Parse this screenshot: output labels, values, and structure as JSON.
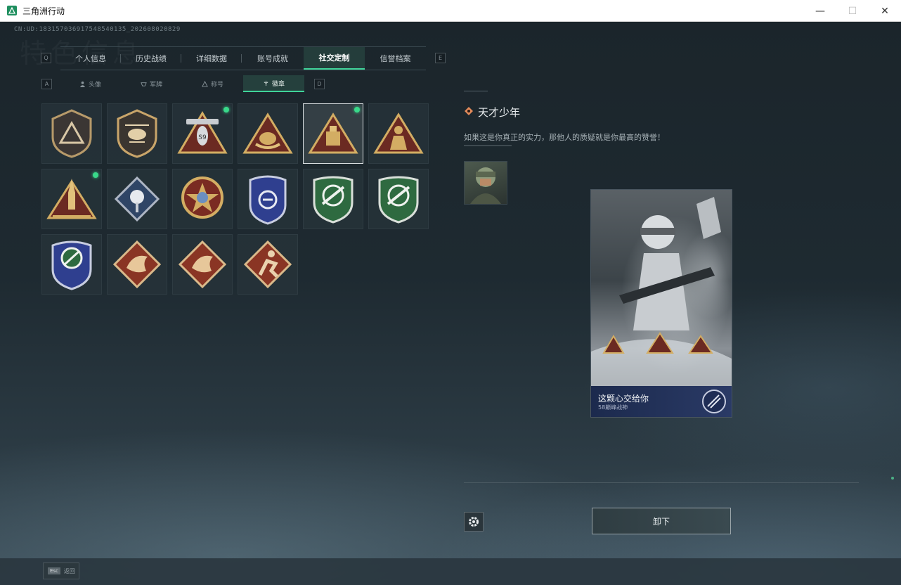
{
  "window": {
    "title": "三角洲行动",
    "minimize": "—",
    "maximize": "☐",
    "close": "✕"
  },
  "uid": "CN:UD:183157036917548540135_202608020829",
  "watermark": "特色信息",
  "main_tabs": {
    "left_key": "Q",
    "right_key": "E",
    "items": [
      {
        "label": "个人信息",
        "active": false
      },
      {
        "label": "历史战绩",
        "active": false
      },
      {
        "label": "详细数据",
        "active": false
      },
      {
        "label": "账号成就",
        "active": false
      },
      {
        "label": "社交定制",
        "active": true
      },
      {
        "label": "信誉档案",
        "active": false
      }
    ]
  },
  "sub_tabs": {
    "left_key": "A",
    "right_key": "D",
    "items": [
      {
        "label": "头像",
        "icon": "person-icon",
        "active": false
      },
      {
        "label": "军牌",
        "icon": "dogtag-icon",
        "active": false
      },
      {
        "label": "称号",
        "icon": "title-icon",
        "active": false
      },
      {
        "label": "徽章",
        "icon": "badge-icon",
        "active": true
      }
    ]
  },
  "badges": [
    {
      "icon": "shield-triangle-badge-icon",
      "new": false,
      "selected": false
    },
    {
      "icon": "helicopter-badge-icon",
      "new": false,
      "selected": false
    },
    {
      "icon": "s59-triangle-badge-icon",
      "new": true,
      "selected": false
    },
    {
      "icon": "nest-triangle-badge-icon",
      "new": false,
      "selected": false
    },
    {
      "icon": "lock-triangle-badge-icon",
      "new": true,
      "selected": true
    },
    {
      "icon": "soldier-triangle-badge-icon",
      "new": false,
      "selected": false
    },
    {
      "icon": "rocket-triangle-badge-icon",
      "new": true,
      "selected": false
    },
    {
      "icon": "flower-diamond-badge-icon",
      "new": false,
      "selected": false
    },
    {
      "icon": "star-round-badge-icon",
      "new": false,
      "selected": false
    },
    {
      "icon": "blue-shield-badge-icon",
      "new": false,
      "selected": false
    },
    {
      "icon": "green-rifle-badge-icon",
      "new": false,
      "selected": false
    },
    {
      "icon": "green-rifle-badge-2-icon",
      "new": false,
      "selected": false
    },
    {
      "icon": "blue-crosshair-badge-icon",
      "new": false,
      "selected": false
    },
    {
      "icon": "dragon-diamond-badge-icon",
      "new": false,
      "selected": false
    },
    {
      "icon": "dragon-diamond-badge-2-icon",
      "new": false,
      "selected": false
    },
    {
      "icon": "runner-diamond-badge-icon",
      "new": false,
      "selected": false
    }
  ],
  "detail": {
    "name": "天才少年",
    "description": "如果这是你真正的实力，那他人的质疑就是你最高的赞誉！"
  },
  "card": {
    "title": "这颗心交给你",
    "subtitle": "58巅峰战神"
  },
  "unequip_label": "卸下",
  "return": {
    "key": "Esc",
    "label": "返回"
  }
}
